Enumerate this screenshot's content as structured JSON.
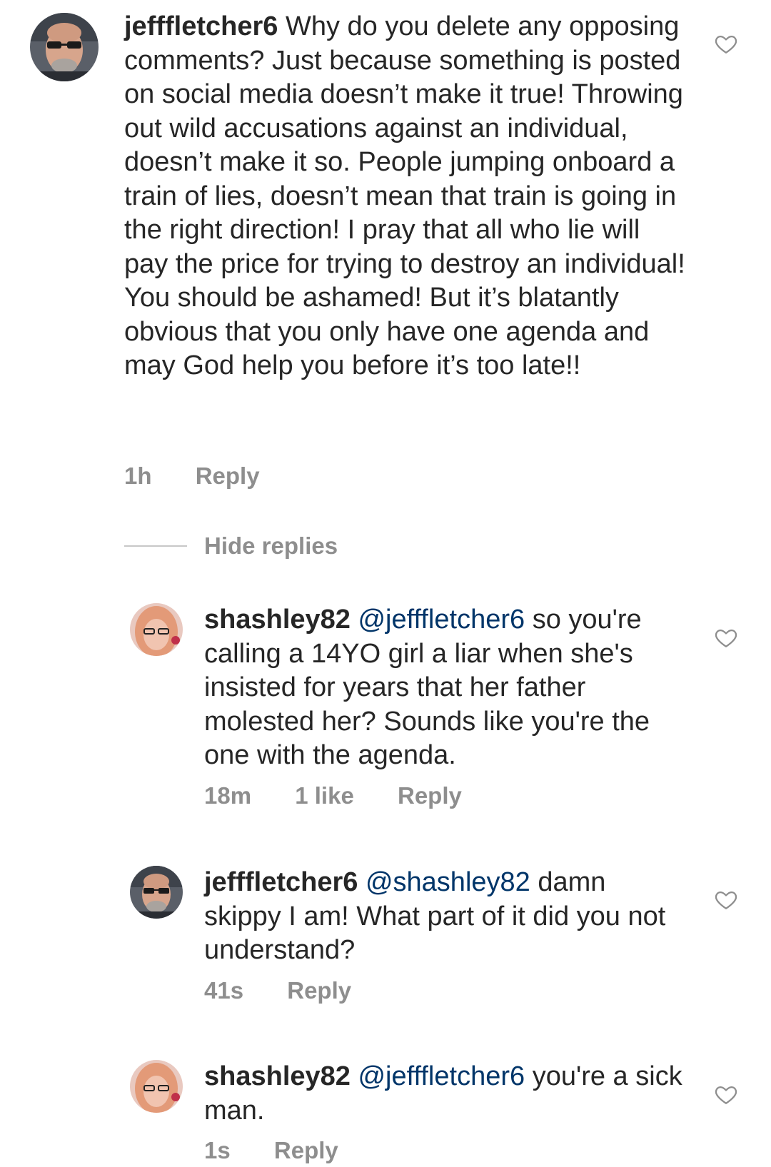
{
  "comments": [
    {
      "username": "jefffletcher6",
      "mention": "",
      "text": "Why do you delete any opposing comments? Just because something is posted on social media doesn’t make it true! Throwing out wild accusations against an individual, doesn’t make it so. People jumping onboard a train of lies, doesn’t mean that train is going in the right direction! I pray that all who lie will pay the price for trying to destroy an individual! You should be ashamed! But it’s blatantly obvious that you only have one agenda and may God help you before it’s too late!!",
      "time": "1h",
      "likes": "",
      "reply_label": "Reply",
      "avatar_icon": "man-with-sunglasses-avatar",
      "heart_icon": "heart-outline-icon"
    }
  ],
  "thread": {
    "hide_replies_label": "Hide replies"
  },
  "replies": [
    {
      "username": "shashley82",
      "mention": "@jefffletcher6",
      "text": "so you're calling a 14YO girl a liar when she's insisted for years that her father molested her? Sounds like you're the one with the agenda.",
      "time": "18m",
      "likes": "1 like",
      "reply_label": "Reply",
      "avatar_icon": "woman-with-glasses-avatar",
      "heart_icon": "heart-outline-icon"
    },
    {
      "username": "jefffletcher6",
      "mention": "@shashley82",
      "text": "damn skippy I am! What part of it did you not understand?",
      "time": "41s",
      "likes": "",
      "reply_label": "Reply",
      "avatar_icon": "man-with-sunglasses-avatar",
      "heart_icon": "heart-outline-icon"
    },
    {
      "username": "shashley82",
      "mention": "@jefffletcher6",
      "text": "you're a sick man.",
      "time": "1s",
      "likes": "",
      "reply_label": "Reply",
      "avatar_icon": "woman-with-glasses-avatar",
      "heart_icon": "heart-outline-icon"
    }
  ],
  "colors": {
    "text": "#262626",
    "secondary_text": "#8e8e8e",
    "mention": "#003569",
    "divider": "#c7c7c7",
    "background": "#ffffff"
  }
}
